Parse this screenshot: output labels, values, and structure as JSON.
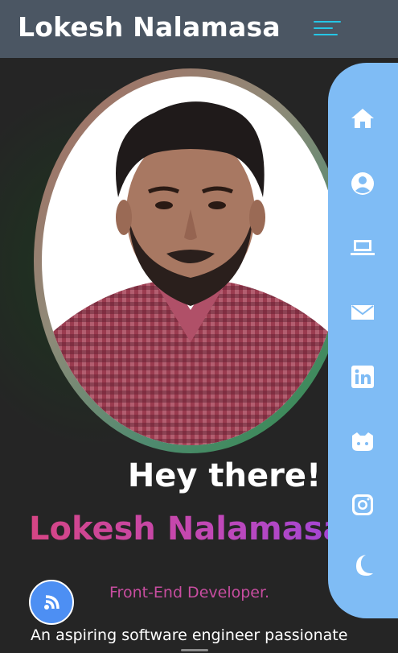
{
  "header": {
    "brand": "Lokesh Nalamasa"
  },
  "hero": {
    "greeting": "Hey there! I'm",
    "name": "Lokesh Nalamasa",
    "role": "Front-End Developer.",
    "about_snippet": "An aspiring software engineer passionate"
  },
  "sidenav": {
    "items": [
      {
        "icon": "home-icon"
      },
      {
        "icon": "user-icon"
      },
      {
        "icon": "laptop-icon"
      },
      {
        "icon": "mail-icon"
      },
      {
        "icon": "linkedin-icon"
      },
      {
        "icon": "github-icon"
      },
      {
        "icon": "instagram-icon"
      },
      {
        "icon": "moon-icon"
      }
    ]
  },
  "colors": {
    "header_bg": "#4b5663",
    "page_bg": "#242424",
    "sidenav_bg": "#7fbcf5",
    "menu_icon": "#25c6e6",
    "name_gradient": [
      "#d64584",
      "#a046d8"
    ],
    "role": "#c84da0",
    "fab_bg": "#4d8ff3"
  }
}
